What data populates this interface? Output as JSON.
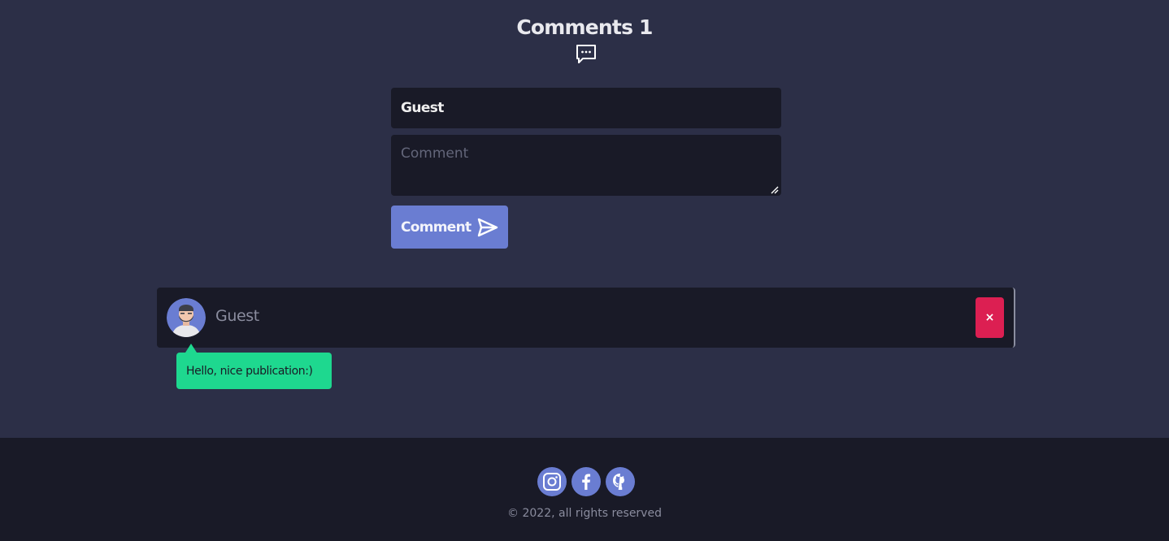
{
  "header": {
    "title": "Comments 1",
    "icon": "chat-bubble-icon"
  },
  "form": {
    "name_value": "Guest",
    "comment_placeholder": "Comment",
    "submit_label": "Comment",
    "submit_icon": "send-icon"
  },
  "comments": [
    {
      "author": "Guest",
      "avatar": "bearded-man-avatar",
      "delete_label": "×",
      "text": "Hello, nice publication:)"
    }
  ],
  "footer": {
    "social": [
      {
        "icon": "instagram-icon"
      },
      {
        "icon": "facebook-icon"
      },
      {
        "icon": "github-icon"
      }
    ],
    "copyright": "© 2022, all rights reserved"
  },
  "colors": {
    "background": "#2c2f47",
    "panel": "#191a27",
    "accent": "#6a7dd2",
    "danger": "#dc1f52",
    "bubble": "#1ed88f"
  }
}
